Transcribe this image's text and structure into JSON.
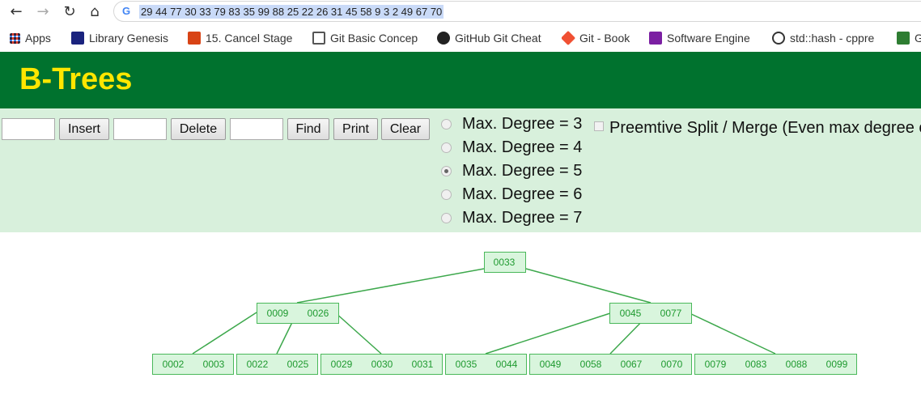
{
  "browser": {
    "url": "29 44 77 30 33 79 83 35 99 88 25 22 26 31 45 58 9 3 2 49 67 70",
    "bookmarks": [
      {
        "label": "Apps",
        "color": "#4285f4"
      },
      {
        "label": "Library Genesis",
        "color": "#1a237e"
      },
      {
        "label": "15. Cancel Stage",
        "color": "#d84315"
      },
      {
        "label": "Git Basic Concep",
        "color": "#555555"
      },
      {
        "label": "GitHub Git Cheat",
        "color": "#222222"
      },
      {
        "label": "Git - Book",
        "color": "#f05033"
      },
      {
        "label": "Software Engine",
        "color": "#7b1fa2"
      },
      {
        "label": "std::hash - cppre",
        "color": "#333333"
      },
      {
        "label": "G",
        "color": "#2e7d32"
      }
    ]
  },
  "page": {
    "title": "B-Trees",
    "insert_label": "Insert",
    "delete_label": "Delete",
    "find_label": "Find",
    "print_label": "Print",
    "clear_label": "Clear",
    "degree_options": [
      "Max. Degree = 3",
      "Max. Degree = 4",
      "Max. Degree = 5",
      "Max. Degree = 6",
      "Max. Degree = 7"
    ],
    "selected_degree": "Max. Degree = 5",
    "preemptive_label": "Preemtive Split / Merge (Even max degree o",
    "preemptive_checked": false
  },
  "colors": {
    "header_bg": "#00722e",
    "title": "#ffe600",
    "controls_bg": "#d8f0dc",
    "node_fill": "#d9f5dd",
    "node_stroke": "#4ab85a",
    "node_text": "#1f9a30",
    "edge": "#3da84c"
  },
  "tree": {
    "root": [
      "0033"
    ],
    "level1": [
      [
        "0009",
        "0026"
      ],
      [
        "0045",
        "0077"
      ]
    ],
    "leaves": [
      [
        "0002",
        "0003"
      ],
      [
        "0022",
        "0025"
      ],
      [
        "0029",
        "0030",
        "0031"
      ],
      [
        "0035",
        "0044"
      ],
      [
        "0049",
        "0058",
        "0067",
        "0070"
      ],
      [
        "0079",
        "0083",
        "0088",
        "0099"
      ]
    ]
  }
}
